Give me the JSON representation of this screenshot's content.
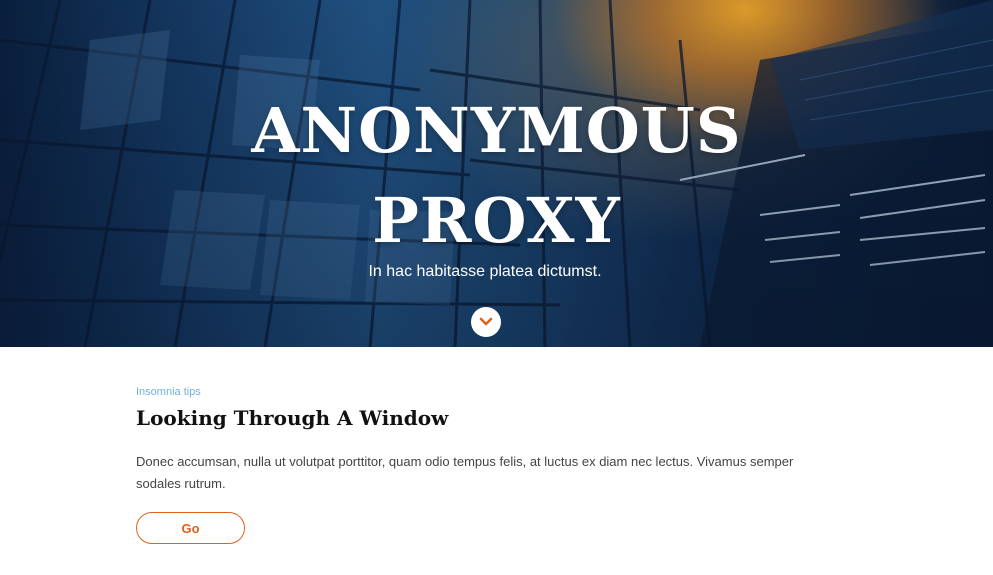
{
  "hero": {
    "title_line1": "ANONYMOUS",
    "title_line2": "PROXY",
    "subtitle": "In hac habitasse platea dictumst.",
    "scroll_icon": "chevron-down-icon"
  },
  "post": {
    "category": "Insomnia tips",
    "title": "Looking Through A Window",
    "excerpt": "Donec accumsan, nulla ut volutpat porttitor, quam odio tempus felis, at luctus ex diam nec lectus. Vivamus semper sodales rutrum.",
    "button_label": "Go"
  },
  "colors": {
    "accent": "#e0621a",
    "category": "#6fb1e0",
    "title": "#111111",
    "text": "#444444"
  }
}
